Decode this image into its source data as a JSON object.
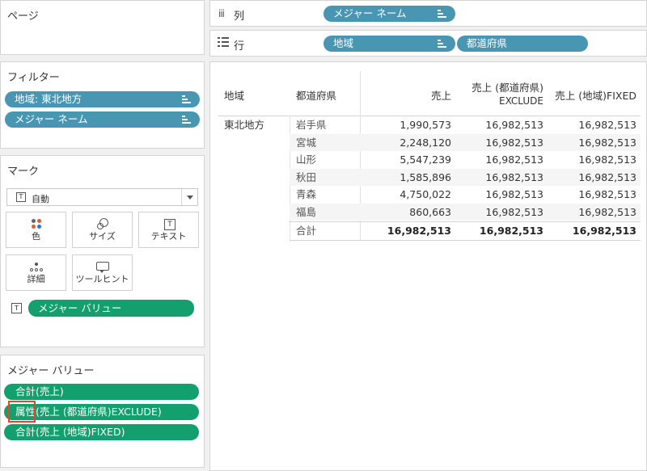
{
  "pages_card": {
    "title": "ページ"
  },
  "shelves": {
    "columns": {
      "label": "列",
      "pills": [
        "メジャー ネーム"
      ]
    },
    "rows": {
      "label": "行",
      "pills": [
        "地域",
        "都道府県"
      ]
    }
  },
  "filters_card": {
    "title": "フィルター",
    "pills": [
      "地域: 東北地方",
      "メジャー ネーム"
    ]
  },
  "marks_card": {
    "title": "マーク",
    "mark_type": "自動",
    "buttons": [
      "色",
      "サイズ",
      "テキスト",
      "詳細",
      "ツールヒント"
    ],
    "text_pill": "メジャー バリュー"
  },
  "measure_values_card": {
    "title": "メジャー バリュー",
    "pills": [
      "合計(売上)",
      "属性(売上 (都道府県)EXCLUDE)",
      "合計(売上 (地域)FIXED)"
    ]
  },
  "table": {
    "headers": {
      "region": "地域",
      "prefecture": "都道府県",
      "sales": "売上",
      "exclude_line1": "売上 (都道府県)",
      "exclude_line2": "EXCLUDE",
      "fixed": "売上 (地域)FIXED"
    },
    "region": "東北地方",
    "rows": [
      [
        "岩手県",
        "1,990,573",
        "16,982,513",
        "16,982,513"
      ],
      [
        "宮城",
        "2,248,120",
        "16,982,513",
        "16,982,513"
      ],
      [
        "山形",
        "5,547,239",
        "16,982,513",
        "16,982,513"
      ],
      [
        "秋田",
        "1,585,896",
        "16,982,513",
        "16,982,513"
      ],
      [
        "青森",
        "4,750,022",
        "16,982,513",
        "16,982,513"
      ],
      [
        "福島",
        "860,663",
        "16,982,513",
        "16,982,513"
      ]
    ],
    "total": [
      "合計",
      "16,982,513",
      "16,982,513",
      "16,982,513"
    ]
  },
  "colors": {
    "dimension_pill": "#4996b2",
    "measure_pill": "#14a06e",
    "highlight": "#e0492e"
  }
}
